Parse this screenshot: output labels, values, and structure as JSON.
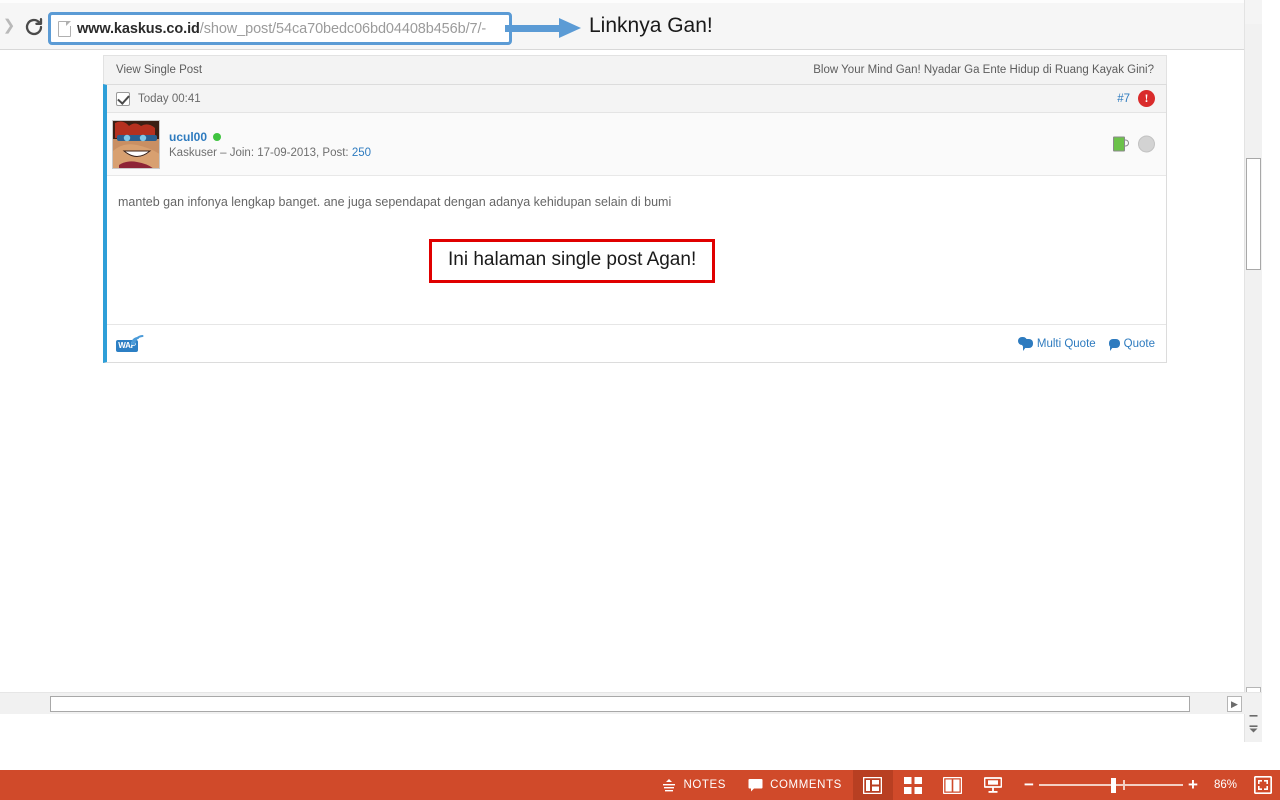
{
  "browser": {
    "forward_icon": "forward-arrow-icon",
    "reload_icon": "reload-icon",
    "page_icon": "page-document-icon",
    "url_host": "www.kaskus.co.id",
    "url_path": "/show_post/54ca70bedc06bd04408b456b/7/-",
    "url_full": "www.kaskus.co.id/show_post/54ca70bedc06bd04408b456b/7/-"
  },
  "annotations": {
    "arrow_label": "Linknya Gan!",
    "arrow_color": "#5b9bd5",
    "box_label": "Ini halaman single post Agan!",
    "box_border_color": "#e00000"
  },
  "page": {
    "topbar_left": "View Single Post",
    "topbar_right": "Blow Your Mind Gan! Nyadar Ga Ente Hidup di Ruang Kayak Gini?",
    "post": {
      "timestamp": "Today 00:41",
      "post_number": "#7",
      "report_icon": "report-exclamation-icon",
      "checkbox_checked": true,
      "username": "ucul00",
      "online_status": "online",
      "user_subtitle": "Kaskuser – Join: 17-09-2013, Post: ",
      "post_count": "250",
      "body_text": "manteb gan infonya lengkap banget. ane juga sependapat dengan adanya kehidupan selain di bumi",
      "wap_label": "WAP",
      "multi_quote_label": "Multi Quote",
      "quote_label": "Quote",
      "accent_color": "#2e9fd8",
      "link_color": "#2e7bbf"
    }
  },
  "statusbar": {
    "notes_label": "NOTES",
    "comments_label": "COMMENTS",
    "views": [
      {
        "name": "normal-view",
        "active": true
      },
      {
        "name": "slide-sorter-view",
        "active": false
      },
      {
        "name": "reading-view",
        "active": false
      },
      {
        "name": "slide-show-view",
        "active": false
      }
    ],
    "zoom_minus": "−",
    "zoom_plus": "+",
    "zoom_percent": "86%",
    "fit_icon": "fit-to-window-icon",
    "background_color": "#d04a2a"
  },
  "scrollbars": {
    "vertical_down": "▼",
    "vertical_prev": "▲",
    "vertical_next": "▼",
    "horizontal_right": "▶"
  }
}
